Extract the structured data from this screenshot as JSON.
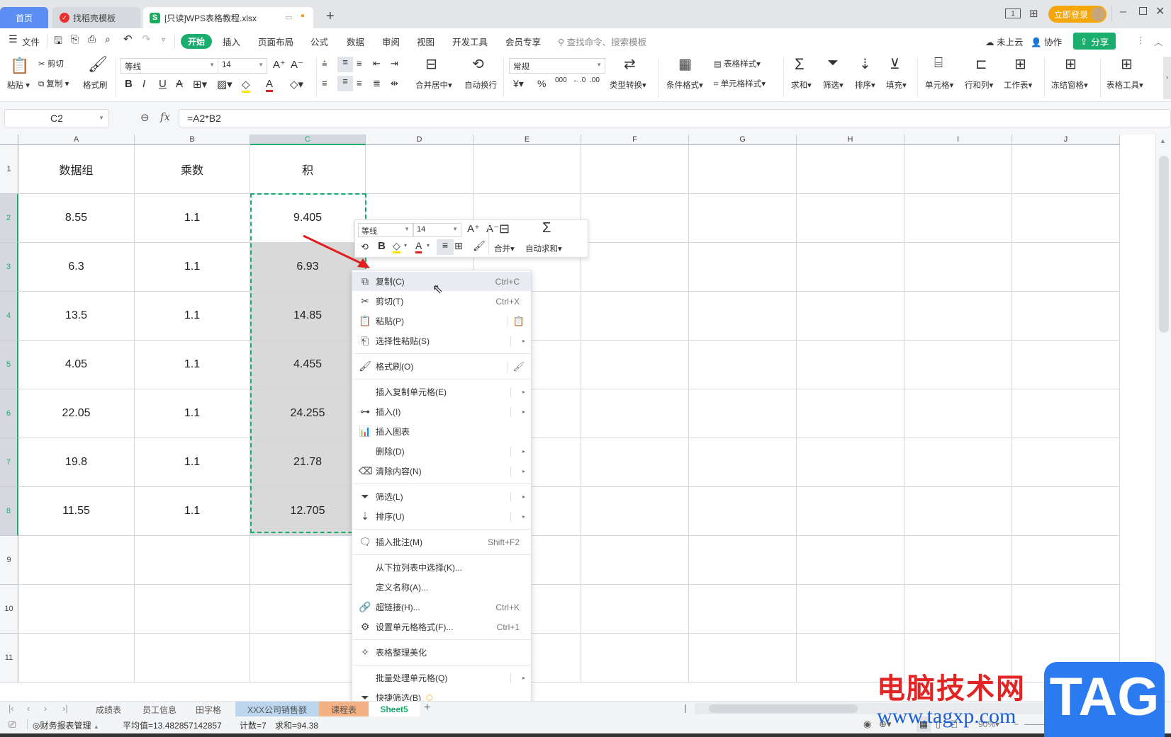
{
  "tabs": {
    "home": "首页",
    "template": "找稻壳模板",
    "document": "[只读]WPS表格教程.xlsx",
    "new_tab": "+"
  },
  "window": {
    "login_button": "立即登录"
  },
  "menu": {
    "file": "文件",
    "items": [
      "开始",
      "插入",
      "页面布局",
      "公式",
      "数据",
      "审阅",
      "视图",
      "开发工具",
      "会员专享"
    ],
    "search_placeholder": "查找命令、搜索模板",
    "cloud": "未上云",
    "collab": "协作",
    "share": "分享"
  },
  "ribbon": {
    "paste": "粘贴",
    "cut": "剪切",
    "copy": "复制",
    "format_painter": "格式刷",
    "font_name": "等线",
    "font_size": "14",
    "merge_center": "合并居中",
    "wrap_text": "自动换行",
    "number_format": "常规",
    "type_convert": "类型转换",
    "cond_format": "条件格式",
    "table_style": "表格样式",
    "cell_style": "单元格样式",
    "sum": "求和",
    "filter": "筛选",
    "sort": "排序",
    "fill": "填充",
    "cell": "单元格",
    "row_col": "行和列",
    "worksheet": "工作表",
    "freeze": "冻结窗格",
    "table_tools": "表格工具"
  },
  "formula_bar": {
    "name_box": "C2",
    "fx": "fx",
    "formula": "=A2*B2"
  },
  "grid": {
    "columns": [
      "A",
      "B",
      "C",
      "D",
      "E",
      "F",
      "G",
      "H",
      "I",
      "J"
    ],
    "rows": [
      "1",
      "2",
      "3",
      "4",
      "5",
      "6",
      "7",
      "8",
      "9",
      "10",
      "11"
    ],
    "header_row": [
      "数据组",
      "乘数",
      "积"
    ],
    "data": [
      [
        "8.55",
        "1.1",
        "9.405"
      ],
      [
        "6.3",
        "1.1",
        "6.93"
      ],
      [
        "13.5",
        "1.1",
        "14.85"
      ],
      [
        "4.05",
        "1.1",
        "4.455"
      ],
      [
        "22.05",
        "1.1",
        "24.255"
      ],
      [
        "19.8",
        "1.1",
        "21.78"
      ],
      [
        "11.55",
        "1.1",
        "12.705"
      ]
    ],
    "selected_cell": "C2"
  },
  "mini_toolbar": {
    "font_name": "等线",
    "font_size": "14",
    "merge": "合并",
    "autosum": "自动求和"
  },
  "context_menu": [
    {
      "label": "复制(C)",
      "shortcut": "Ctrl+C",
      "icon": "copy-icon",
      "highlight": true
    },
    {
      "label": "剪切(T)",
      "shortcut": "Ctrl+X",
      "icon": "cut-icon"
    },
    {
      "label": "粘贴(P)",
      "shortcut": "",
      "icon": "paste-icon",
      "extra": "paste-values-icon"
    },
    {
      "label": "选择性粘贴(S)",
      "shortcut": "",
      "icon": "paste-special-icon",
      "submenu": true
    },
    {
      "label": "格式刷(O)",
      "shortcut": "",
      "icon": "format-painter-icon",
      "extra": "format-painter-lock-icon"
    },
    {
      "label": "插入复制单元格(E)",
      "shortcut": "",
      "icon": "",
      "submenu": true
    },
    {
      "label": "插入(I)",
      "shortcut": "",
      "icon": "insert-icon",
      "submenu": true
    },
    {
      "label": "插入图表",
      "shortcut": "",
      "icon": "chart-icon"
    },
    {
      "label": "删除(D)",
      "shortcut": "",
      "icon": "",
      "submenu": true
    },
    {
      "label": "清除内容(N)",
      "shortcut": "",
      "icon": "clear-icon",
      "submenu": true
    },
    {
      "label": "筛选(L)",
      "shortcut": "",
      "icon": "filter-icon",
      "submenu": true
    },
    {
      "label": "排序(U)",
      "shortcut": "",
      "icon": "sort-icon",
      "submenu": true
    },
    {
      "label": "插入批注(M)",
      "shortcut": "Shift+F2",
      "icon": "comment-icon"
    },
    {
      "label": "从下拉列表中选择(K)...",
      "shortcut": "",
      "icon": ""
    },
    {
      "label": "定义名称(A)...",
      "shortcut": "",
      "icon": ""
    },
    {
      "label": "超链接(H)...",
      "shortcut": "Ctrl+K",
      "icon": "link-icon"
    },
    {
      "label": "设置单元格格式(F)...",
      "shortcut": "Ctrl+1",
      "icon": "cell-format-icon"
    },
    {
      "label": "表格整理美化",
      "shortcut": "",
      "icon": "beautify-icon"
    },
    {
      "label": "批量处理单元格(Q)",
      "shortcut": "",
      "icon": "",
      "submenu": true
    },
    {
      "label": "快捷筛选(B)",
      "shortcut": "",
      "icon": "quick-filter-icon",
      "badge": "vip"
    }
  ],
  "sheet_tabs": [
    {
      "name": "成绩表",
      "color": ""
    },
    {
      "name": "员工信息",
      "color": ""
    },
    {
      "name": "田字格",
      "color": ""
    },
    {
      "name": "XXX公司销售额",
      "color": "#bcd6ee"
    },
    {
      "name": "课程表",
      "color": "#f4b183"
    },
    {
      "name": "Sheet5",
      "color": "",
      "active": true
    }
  ],
  "status_bar": {
    "macro": "财务报表管理",
    "average": "平均值=13.482857142857",
    "count": "计数=7",
    "sum": "求和=94.38",
    "zoom": "90%"
  },
  "watermark": {
    "title": "电脑技术网",
    "url": "www.tagxp.com",
    "logo": "TAG"
  },
  "colors": {
    "accent": "#1aad6d",
    "home_tab": "#5b8ef5",
    "login": "#f5a60a",
    "selection_fill": "#d9d9d9"
  }
}
